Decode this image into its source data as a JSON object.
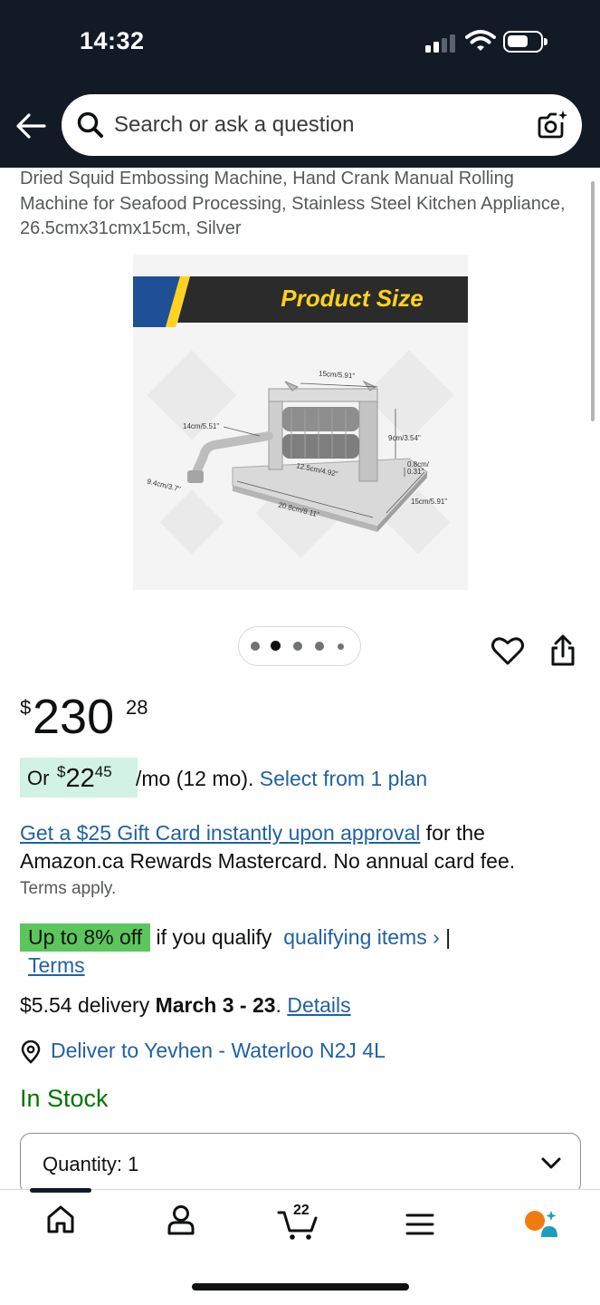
{
  "status_bar": {
    "time": "14:32"
  },
  "search": {
    "placeholder": "Search or ask a question"
  },
  "product": {
    "title": "Dried Squid Embossing Machine, Hand Crank Manual Rolling Machine for Seafood Processing, Stainless Steel Kitchen Appliance, 26.5cmx31cmx15cm, Silver",
    "image": {
      "banner": "Product Size",
      "dimensions": [
        "15cm/5.91\"",
        "14cm/5.51\"",
        "9cm/3.54\"",
        "0.8cm/ 0.31\"",
        "12.5cm/4.92\"",
        "9.4cm/3.7\"",
        "20.8cm/8.11\"",
        "15cm/5.91\""
      ]
    },
    "carousel": {
      "count": 5,
      "active_index": 1
    }
  },
  "price": {
    "symbol": "$",
    "whole": "230",
    "fraction": "28"
  },
  "installment": {
    "prefix": "Or",
    "symbol": "$",
    "whole": "22",
    "fraction": "45",
    "suffix": "/mo (12 mo).",
    "link": "Select from 1 plan"
  },
  "rewards": {
    "link": "Get a $25 Gift Card instantly upon approval",
    "text": " for the Amazon.ca Rewards Mastercard. No annual card fee.",
    "terms": "Terms apply."
  },
  "promo": {
    "badge": "Up to 8% off",
    "text": "if you qualify",
    "link": "qualifying items ›",
    "separator": "|",
    "terms_link": "Terms"
  },
  "delivery": {
    "fee": "$5.54 delivery",
    "dates": "March 3 - 23",
    "period": ".",
    "details": "Details"
  },
  "deliver_to": "Deliver to Yevhen - Waterloo N2J 4L",
  "stock": "In Stock",
  "quantity": {
    "label": "Quantity:",
    "value": "1"
  },
  "bottom_nav": {
    "cart_count": "22"
  },
  "colors": {
    "header_bg": "#121a26",
    "link": "#2162a1",
    "in_stock": "#007600",
    "installment_bg": "#d1f2e4",
    "promo_badge": "#5cc65c"
  },
  "icons": {
    "back": "arrow-left-icon",
    "search": "search-icon",
    "camera": "camera-search-icon",
    "heart": "heart-icon",
    "share": "share-icon",
    "location": "location-pin-icon",
    "home": "home-icon",
    "account": "account-icon",
    "cart": "cart-icon",
    "menu": "menu-icon",
    "assistant": "assistant-icon"
  }
}
